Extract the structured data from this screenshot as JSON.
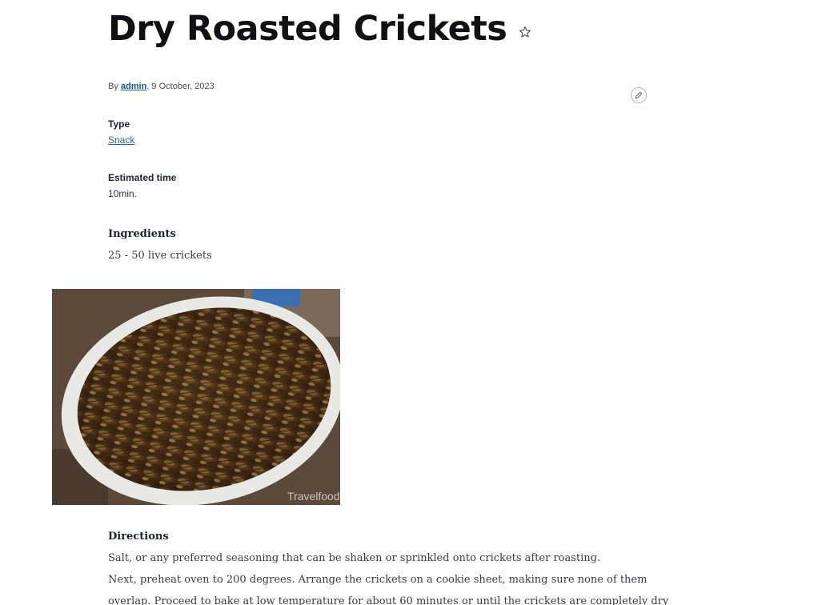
{
  "article": {
    "title": "Dry Roasted Crickets",
    "byline_prefix": "By",
    "author": "admin",
    "date": ", 9 October, 2023"
  },
  "fields": {
    "type_label": "Type",
    "type_value": "Snack",
    "time_label": "Estimated time",
    "time_value": "10min."
  },
  "ingredients": {
    "label": "Ingredients",
    "items": [
      "25 - 50 live crickets"
    ]
  },
  "image": {
    "watermark": "Travelfood"
  },
  "directions": {
    "label": "Directions",
    "lines": [
      "Salt, or any preferred seasoning that can be shaken or sprinkled onto crickets after roasting.",
      "Next, preheat oven to 200 degrees. Arrange the crickets on a cookie sheet, making sure none of them",
      "overlap. Proceed to bake at low temperature for about 60 minutes or until the crickets are completely dry"
    ]
  },
  "icons": {
    "favorite": "star-icon",
    "edit": "pencil-icon"
  }
}
